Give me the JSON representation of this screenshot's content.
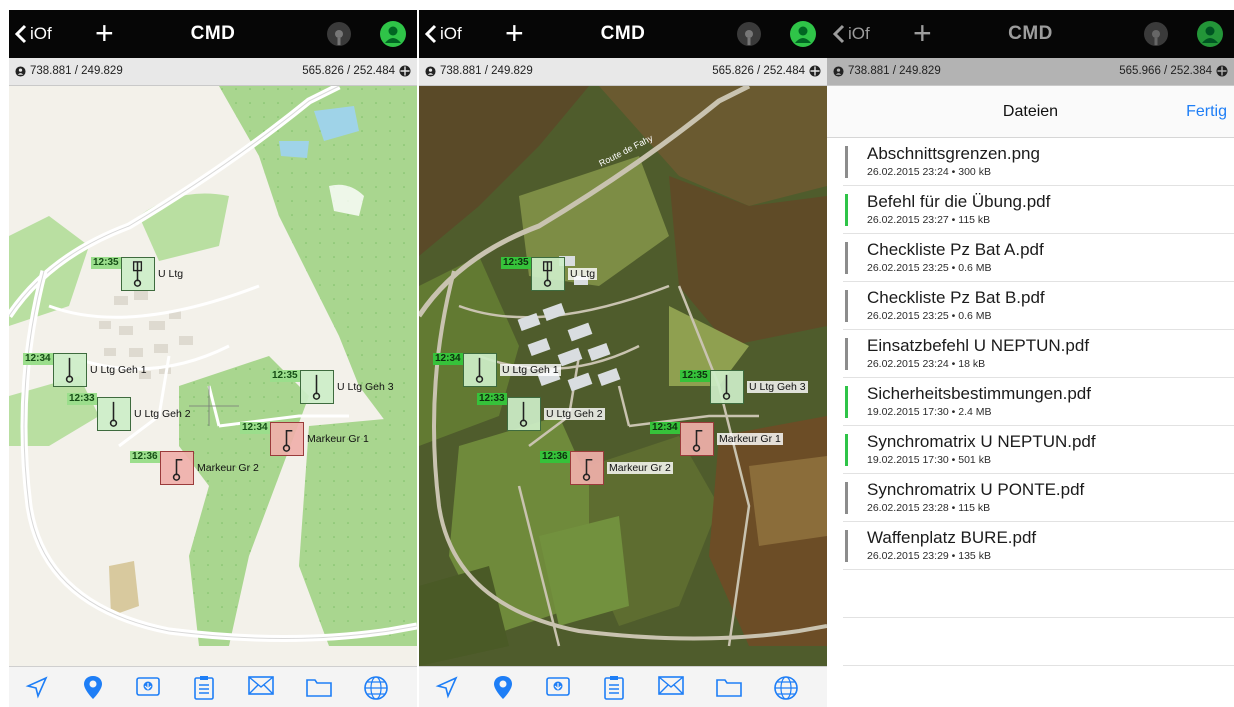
{
  "screens": [
    {
      "id": "map",
      "navbar": {
        "back_label": "iOf",
        "plus_label": "+",
        "title": "CMD"
      },
      "coords": {
        "left": "738.881 / 249.829",
        "right": "565.826 / 252.484"
      },
      "road_label": "",
      "markers": [
        {
          "time": "12:35",
          "label": "U Ltg",
          "type": "green"
        },
        {
          "time": "12:34",
          "label": "U Ltg Geh 1",
          "type": "green"
        },
        {
          "time": "12:33",
          "label": "U Ltg Geh 2",
          "type": "green"
        },
        {
          "time": "12:35",
          "label": "U Ltg Geh 3",
          "type": "green"
        },
        {
          "time": "12:34",
          "label": "Markeur Gr 1",
          "type": "red"
        },
        {
          "time": "12:36",
          "label": "Markeur Gr 2",
          "type": "red"
        }
      ],
      "tabs": [
        "location-arrow-icon",
        "map-pin-icon",
        "gps-import-icon",
        "clipboard-icon",
        "mail-icon",
        "folder-icon",
        "globe-icon"
      ]
    },
    {
      "id": "satellite",
      "navbar": {
        "back_label": "iOf",
        "plus_label": "+",
        "title": "CMD"
      },
      "coords": {
        "left": "738.881 / 249.829",
        "right": "565.826 / 252.484"
      },
      "road_label": "Route de Fahy",
      "markers": [
        {
          "time": "12:35",
          "label": "U Ltg",
          "type": "green"
        },
        {
          "time": "12:34",
          "label": "U Ltg Geh 1",
          "type": "green"
        },
        {
          "time": "12:33",
          "label": "U Ltg Geh 2",
          "type": "green"
        },
        {
          "time": "12:35",
          "label": "U Ltg Geh 3",
          "type": "green"
        },
        {
          "time": "12:34",
          "label": "Markeur Gr 1",
          "type": "red"
        },
        {
          "time": "12:36",
          "label": "Markeur Gr 2",
          "type": "red"
        }
      ]
    },
    {
      "id": "files",
      "navbar": {
        "back_label": "iOf",
        "plus_label": "+",
        "title": "CMD"
      },
      "coords": {
        "left": "738.881 / 249.829",
        "right": "565.966 / 252.384"
      },
      "sheet": {
        "title": "Dateien",
        "done_label": "Fertig"
      },
      "files": [
        {
          "name": "Abschnittsgrenzen.png",
          "meta": "26.02.2015 23:24 • 300 kB",
          "new": false
        },
        {
          "name": "Befehl für die Übung.pdf",
          "meta": "26.02.2015 23:27 • 115 kB",
          "new": true
        },
        {
          "name": "Checkliste Pz Bat A.pdf",
          "meta": "26.02.2015 23:25 • 0.6 MB",
          "new": false
        },
        {
          "name": "Checkliste Pz Bat B.pdf",
          "meta": "26.02.2015 23:25 • 0.6 MB",
          "new": false
        },
        {
          "name": "Einsatzbefehl U NEPTUN.pdf",
          "meta": "26.02.2015 23:24 • 18 kB",
          "new": false
        },
        {
          "name": "Sicherheitsbestimmungen.pdf",
          "meta": "19.02.2015 17:30 • 2.4 MB",
          "new": true
        },
        {
          "name": "Synchromatrix U NEPTUN.pdf",
          "meta": "19.02.2015 17:30 • 501 kB",
          "new": true
        },
        {
          "name": "Synchromatrix U PONTE.pdf",
          "meta": "26.02.2015 23:28 • 115 kB",
          "new": false
        },
        {
          "name": "Waffenplatz BURE.pdf",
          "meta": "26.02.2015 23:29 • 135 kB",
          "new": false
        }
      ]
    }
  ],
  "colors": {
    "navbar": "#060606",
    "accent_green": "#2fc448",
    "link_blue": "#1e7ef6",
    "tab_blue": "#1e7ef6",
    "marker_red": "#f0b0aa",
    "marker_green": "#cdeec8"
  }
}
